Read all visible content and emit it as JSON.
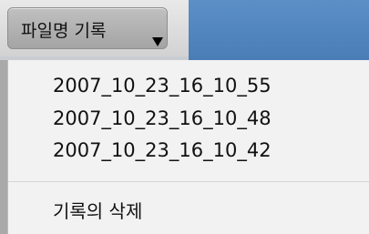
{
  "history_button": {
    "label": "파일명 기록"
  },
  "menu": {
    "items": [
      "2007_10_23_16_10_55",
      "2007_10_23_16_10_48",
      "2007_10_23_16_10_42"
    ],
    "delete_label": "기록의 삭제"
  },
  "colors": {
    "panel_blue": "#4f85c0",
    "menu_background": "#f2f2f2"
  }
}
